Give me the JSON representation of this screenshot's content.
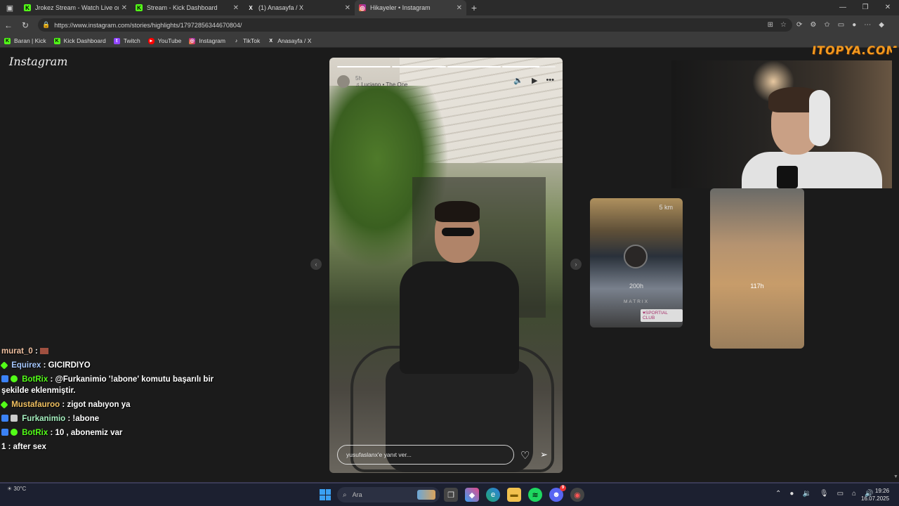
{
  "tabs": [
    {
      "title": "Jrokez Stream - Watch Live on Kick",
      "favicon": "kick-icon",
      "active": false
    },
    {
      "title": "Stream - Kick Dashboard",
      "favicon": "kick-icon",
      "active": false
    },
    {
      "title": "(1) Anasayfa / X",
      "favicon": "x-icon",
      "active": false
    },
    {
      "title": "Hikayeler • Instagram",
      "favicon": "instagram-icon",
      "active": true
    }
  ],
  "address_bar": {
    "url": "https://www.instagram.com/stories/highlights/17972856344670804/"
  },
  "bookmarks": [
    {
      "label": "Baran | Kick",
      "icon": "kick-icon"
    },
    {
      "label": "Kick Dashboard",
      "icon": "kick-icon"
    },
    {
      "label": "Twitch",
      "icon": "twitch-icon"
    },
    {
      "label": "YouTube",
      "icon": "youtube-icon"
    },
    {
      "label": "Instagram",
      "icon": "instagram-icon"
    },
    {
      "label": "TikTok",
      "icon": "tiktok-icon"
    },
    {
      "label": "Anasayfa / X",
      "icon": "x-icon"
    }
  ],
  "instagram": {
    "logo": "Instagram",
    "story": {
      "time": "5h",
      "song": "Luciano • The One",
      "reply_placeholder": "yusufaslanx'e yanıt ver...",
      "progress": {
        "segments": 4,
        "completed": 3,
        "current_fraction": 0.7
      }
    },
    "thumbs": [
      {
        "label": "200h",
        "distance": "5 km",
        "badge": "♥SPORTIAL CLUB",
        "brand": "MATRIX"
      },
      {
        "label": "117h"
      }
    ]
  },
  "overlay": {
    "watermark": "ITOPYA.COM"
  },
  "chat": [
    {
      "user": "murat_0",
      "message": "",
      "color": "#f0c0a0",
      "badge": "none"
    },
    {
      "user": "Equirex",
      "message": "GICIRDIYO",
      "color": "#a6c8ff",
      "badge": "diamond"
    },
    {
      "user": "BotRix",
      "message": "@Furkanimio '!abone' komutu başarılı bir şekilde eklenmiştir.",
      "color": "#53fc18",
      "badge": "bot"
    },
    {
      "user": "Mustafauroo",
      "message": "zigot nabıyon ya",
      "color": "#f0c060",
      "badge": "diamond"
    },
    {
      "user": "Furkanimio",
      "message": "!abone",
      "color": "#a6f0c0",
      "badge": "sub"
    },
    {
      "user": "BotRix",
      "message": "10 , abonemiz var",
      "color": "#53fc18",
      "badge": "bot"
    },
    {
      "user": "1",
      "message": "after sex",
      "color": "#ffffff",
      "badge": "none"
    }
  ],
  "taskbar": {
    "weather": "30°C",
    "search_placeholder": "Ara",
    "time": "19:26",
    "date": "16.07.2025",
    "discord_badge": "9"
  }
}
